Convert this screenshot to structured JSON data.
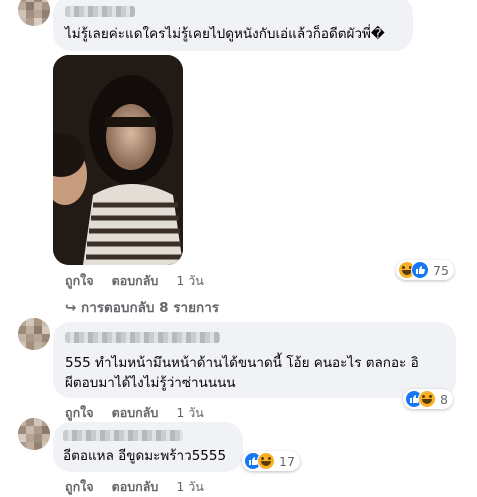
{
  "comments": [
    {
      "text": "ไม่รู้เลยค่ะแดใครไม่รู้เคยไปดูหนังกับเอ่แล้วก็อดีตผัวพี่�",
      "actions": {
        "like": "ถูกใจ",
        "reply": "ตอบกลับ",
        "time": "1 วัน"
      },
      "reactions": {
        "icons": [
          "haha-icon",
          "like-icon"
        ],
        "count": "75"
      },
      "replies_link": "การตอบกลับ 8 รายการ"
    },
    {
      "text_line1": "555 ทำไมหน้ามึนหน้าด้านได้ขนาดนี้ โอ้ย คนอะไร ตลกอะ อิ",
      "text_line2": "ผีตอบมาได้ไงไม่รู้ว่าซ่านนนน",
      "actions": {
        "like": "ถูกใจ",
        "reply": "ตอบกลับ",
        "time": "1 วัน"
      },
      "reactions": {
        "icons": [
          "like-icon",
          "haha-icon"
        ],
        "count": "8"
      }
    },
    {
      "text": "อีตอแหล อีขูดมะพร้าว5555",
      "actions": {
        "like": "ถูกใจ",
        "reply": "ตอบกลับ",
        "time": "1 วัน"
      },
      "reactions": {
        "icons": [
          "like-icon",
          "haha-icon"
        ],
        "count": "17"
      }
    }
  ],
  "colors": {
    "bubble": "#f0f2f5",
    "secondary_text": "#65676b",
    "like_blue": "#1877f2",
    "haha_yellow": "#f7b125"
  }
}
